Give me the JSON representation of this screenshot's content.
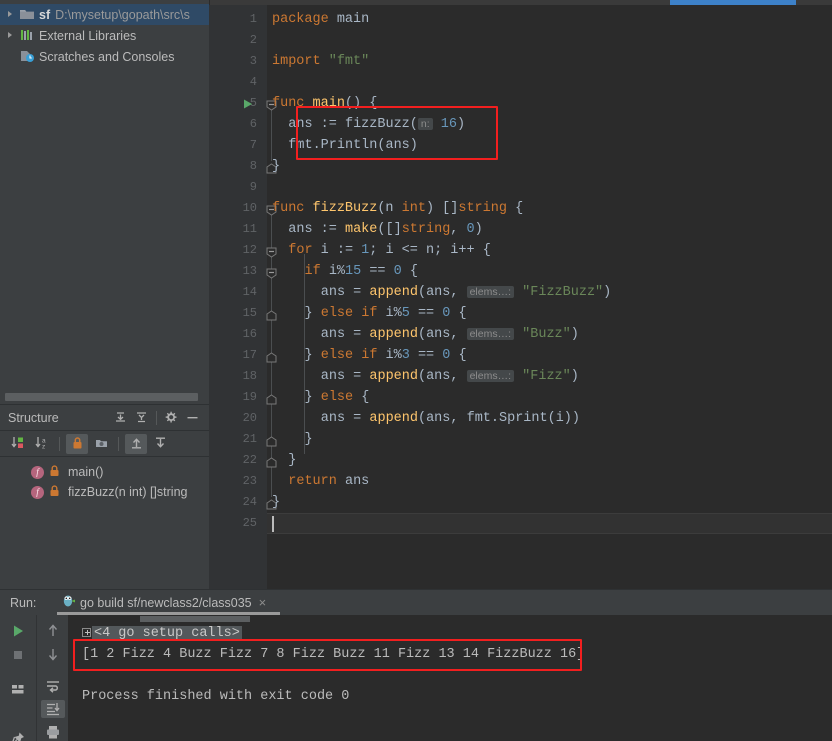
{
  "project": {
    "items": [
      {
        "name": "sf",
        "path": "D:\\mysetup\\gopath\\src\\s",
        "icon": "folder-icon",
        "selected": true,
        "arrow": true
      },
      {
        "name": "External Libraries",
        "path": "",
        "icon": "library-icon",
        "selected": false,
        "arrow": true
      },
      {
        "name": "Scratches and Consoles",
        "path": "",
        "icon": "scratches-icon",
        "selected": false,
        "arrow": false
      }
    ]
  },
  "structure": {
    "title": "Structure",
    "header_icons": [
      "expand-all-icon",
      "collapse-all-icon",
      "settings-gear-icon",
      "hide-icon"
    ],
    "toolbar_icons": [
      "sort-by-visibility-icon",
      "sort-alphabetically-icon",
      "show-non-public-icon",
      "group-by-folder-icon",
      "scroll-from-source-icon",
      "scroll-to-source-icon"
    ],
    "items": [
      {
        "label": "main()",
        "kind": "f",
        "access": "lock-icon"
      },
      {
        "label": "fizzBuzz(n int) []string",
        "kind": "f",
        "access": "lock-icon"
      }
    ]
  },
  "editor": {
    "first_line": 1,
    "caret_line": 25,
    "lines": [
      {
        "n": 1,
        "tokens": [
          {
            "t": "package ",
            "c": "kw"
          },
          {
            "t": "main",
            "c": "plain"
          }
        ],
        "indent": 0
      },
      {
        "n": 2,
        "tokens": [],
        "indent": 0
      },
      {
        "n": 3,
        "tokens": [
          {
            "t": "import ",
            "c": "kw"
          },
          {
            "t": "\"fmt\"",
            "c": "str"
          }
        ],
        "indent": 0
      },
      {
        "n": 4,
        "tokens": [],
        "indent": 0
      },
      {
        "n": 5,
        "tokens": [
          {
            "t": "func ",
            "c": "kw"
          },
          {
            "t": "main",
            "c": "fn"
          },
          {
            "t": "() {",
            "c": "plain"
          }
        ],
        "indent": 0
      },
      {
        "n": 6,
        "tokens": [
          {
            "t": "ans := ",
            "c": "plain"
          },
          {
            "t": "fizzBuzz",
            "c": "plain"
          },
          {
            "t": "(",
            "c": "plain"
          },
          {
            "t": "n:",
            "c": "hint"
          },
          {
            "t": " ",
            "c": "plain"
          },
          {
            "t": "16",
            "c": "num"
          },
          {
            "t": ")",
            "c": "plain"
          }
        ],
        "indent": 1
      },
      {
        "n": 7,
        "tokens": [
          {
            "t": "fmt",
            "c": "plain"
          },
          {
            "t": ".Println(ans)",
            "c": "plain"
          }
        ],
        "indent": 1
      },
      {
        "n": 8,
        "tokens": [
          {
            "t": "}",
            "c": "plain"
          }
        ],
        "indent": 0
      },
      {
        "n": 9,
        "tokens": [],
        "indent": 0
      },
      {
        "n": 10,
        "tokens": [
          {
            "t": "func ",
            "c": "kw"
          },
          {
            "t": "fizzBuzz",
            "c": "fn"
          },
          {
            "t": "(n ",
            "c": "plain"
          },
          {
            "t": "int",
            "c": "kw"
          },
          {
            "t": ") []",
            "c": "plain"
          },
          {
            "t": "string",
            "c": "kw"
          },
          {
            "t": " {",
            "c": "plain"
          }
        ],
        "indent": 0
      },
      {
        "n": 11,
        "tokens": [
          {
            "t": "ans := ",
            "c": "plain"
          },
          {
            "t": "make",
            "c": "fn"
          },
          {
            "t": "([]",
            "c": "plain"
          },
          {
            "t": "string",
            "c": "kw"
          },
          {
            "t": ", ",
            "c": "plain"
          },
          {
            "t": "0",
            "c": "num"
          },
          {
            "t": ")",
            "c": "plain"
          }
        ],
        "indent": 1
      },
      {
        "n": 12,
        "tokens": [
          {
            "t": "for ",
            "c": "kw"
          },
          {
            "t": "i := ",
            "c": "plain"
          },
          {
            "t": "1",
            "c": "num"
          },
          {
            "t": "; i <= n; i++ {",
            "c": "plain"
          }
        ],
        "indent": 1
      },
      {
        "n": 13,
        "tokens": [
          {
            "t": "if ",
            "c": "kw"
          },
          {
            "t": "i%",
            "c": "plain"
          },
          {
            "t": "15",
            "c": "num"
          },
          {
            "t": " == ",
            "c": "plain"
          },
          {
            "t": "0",
            "c": "num"
          },
          {
            "t": " {",
            "c": "plain"
          }
        ],
        "indent": 2
      },
      {
        "n": 14,
        "tokens": [
          {
            "t": "ans = ",
            "c": "plain"
          },
          {
            "t": "append",
            "c": "fn"
          },
          {
            "t": "(ans, ",
            "c": "plain"
          },
          {
            "t": "elems…:",
            "c": "hint"
          },
          {
            "t": " ",
            "c": "plain"
          },
          {
            "t": "\"FizzBuzz\"",
            "c": "str"
          },
          {
            "t": ")",
            "c": "plain"
          }
        ],
        "indent": 3
      },
      {
        "n": 15,
        "tokens": [
          {
            "t": "} ",
            "c": "plain"
          },
          {
            "t": "else if ",
            "c": "kw"
          },
          {
            "t": "i%",
            "c": "plain"
          },
          {
            "t": "5",
            "c": "num"
          },
          {
            "t": " == ",
            "c": "plain"
          },
          {
            "t": "0",
            "c": "num"
          },
          {
            "t": " {",
            "c": "plain"
          }
        ],
        "indent": 2
      },
      {
        "n": 16,
        "tokens": [
          {
            "t": "ans = ",
            "c": "plain"
          },
          {
            "t": "append",
            "c": "fn"
          },
          {
            "t": "(ans, ",
            "c": "plain"
          },
          {
            "t": "elems…:",
            "c": "hint"
          },
          {
            "t": " ",
            "c": "plain"
          },
          {
            "t": "\"Buzz\"",
            "c": "str"
          },
          {
            "t": ")",
            "c": "plain"
          }
        ],
        "indent": 3
      },
      {
        "n": 17,
        "tokens": [
          {
            "t": "} ",
            "c": "plain"
          },
          {
            "t": "else if ",
            "c": "kw"
          },
          {
            "t": "i%",
            "c": "plain"
          },
          {
            "t": "3",
            "c": "num"
          },
          {
            "t": " == ",
            "c": "plain"
          },
          {
            "t": "0",
            "c": "num"
          },
          {
            "t": " {",
            "c": "plain"
          }
        ],
        "indent": 2
      },
      {
        "n": 18,
        "tokens": [
          {
            "t": "ans = ",
            "c": "plain"
          },
          {
            "t": "append",
            "c": "fn"
          },
          {
            "t": "(ans, ",
            "c": "plain"
          },
          {
            "t": "elems…:",
            "c": "hint"
          },
          {
            "t": " ",
            "c": "plain"
          },
          {
            "t": "\"Fizz\"",
            "c": "str"
          },
          {
            "t": ")",
            "c": "plain"
          }
        ],
        "indent": 3
      },
      {
        "n": 19,
        "tokens": [
          {
            "t": "} ",
            "c": "plain"
          },
          {
            "t": "else ",
            "c": "kw"
          },
          {
            "t": "{",
            "c": "plain"
          }
        ],
        "indent": 2
      },
      {
        "n": 20,
        "tokens": [
          {
            "t": "ans = ",
            "c": "plain"
          },
          {
            "t": "append",
            "c": "fn"
          },
          {
            "t": "(ans, fmt.",
            "c": "plain"
          },
          {
            "t": "Sprint",
            "c": "plain"
          },
          {
            "t": "(i))",
            "c": "plain"
          }
        ],
        "indent": 3
      },
      {
        "n": 21,
        "tokens": [
          {
            "t": "}",
            "c": "plain"
          }
        ],
        "indent": 2
      },
      {
        "n": 22,
        "tokens": [
          {
            "t": "}",
            "c": "plain"
          }
        ],
        "indent": 1
      },
      {
        "n": 23,
        "tokens": [
          {
            "t": "return ",
            "c": "kw"
          },
          {
            "t": "ans",
            "c": "plain"
          }
        ],
        "indent": 1
      },
      {
        "n": 24,
        "tokens": [
          {
            "t": "}",
            "c": "plain"
          }
        ],
        "indent": 0
      },
      {
        "n": 25,
        "tokens": [],
        "indent": 0
      }
    ]
  },
  "run": {
    "label": "Run:",
    "tab_title": "go build sf/newclass2/class035",
    "tab_icon": "go-gopher-icon",
    "close_icon": "×",
    "side_icons": [
      "run-icon",
      "stop-icon",
      "layout-icon",
      "pin-icon"
    ],
    "side2_icons": [
      "up-arrow-icon",
      "down-arrow-icon",
      "soft-wrap-icon",
      "scroll-to-end-icon",
      "print-icon"
    ],
    "console": {
      "folded_line": "<4 go setup calls>",
      "output_line": "[1 2 Fizz 4 Buzz Fizz 7 8 Fizz Buzz 11 Fizz 13 14 FizzBuzz 16]",
      "exit_line": "Process finished with exit code 0"
    }
  },
  "colors": {
    "panel_bg": "#3c3f41",
    "editor_bg": "#2b2b2b",
    "gutter_bg": "#313335",
    "selection_blue": "#2f4a66",
    "progress_blue": "#3d81c9",
    "highlight_red": "#f21f1f",
    "keyword_orange": "#cc7832",
    "string_green": "#6a8759",
    "number_blue": "#6897bb",
    "function_yellow": "#ffc66d",
    "text_grey": "#a9b7c6"
  }
}
